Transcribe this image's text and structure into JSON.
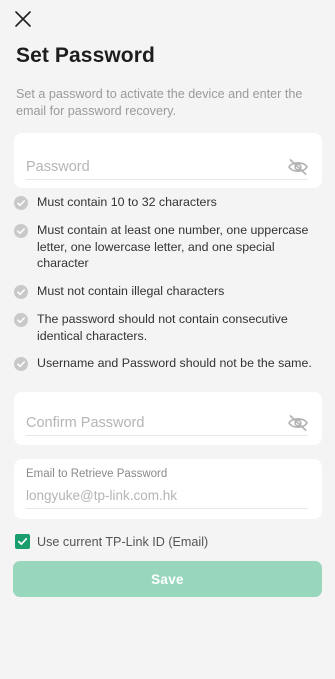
{
  "header": {
    "close_icon": "close-icon",
    "title": "Set Password",
    "description": "Set a password to activate the device and enter the email for password recovery."
  },
  "password": {
    "placeholder": "Password",
    "value": "",
    "toggle_icon": "eye-off-icon"
  },
  "rules": [
    {
      "text": "Must contain 10 to 32 characters",
      "met": false
    },
    {
      "text": "Must contain at least one number, one uppercase letter, one lowercase letter, and one special character",
      "met": false
    },
    {
      "text": "Must not contain illegal characters",
      "met": false
    },
    {
      "text": "The password should not contain consecutive identical characters.",
      "met": false
    },
    {
      "text": "Username and Password should not be the same.",
      "met": false
    }
  ],
  "confirm": {
    "placeholder": "Confirm Password",
    "value": "",
    "toggle_icon": "eye-off-icon"
  },
  "email": {
    "label": "Email to Retrieve Password",
    "placeholder": "longyuke@tp-link.com.hk",
    "value": ""
  },
  "use_current_id": {
    "label": "Use current TP-Link ID (Email)",
    "checked": true
  },
  "save_label": "Save",
  "colors": {
    "accent": "#1a9e6e",
    "save_disabled": "#99d7bd",
    "rule_check": "#c9c9c9",
    "background": "#f4f4f4"
  }
}
